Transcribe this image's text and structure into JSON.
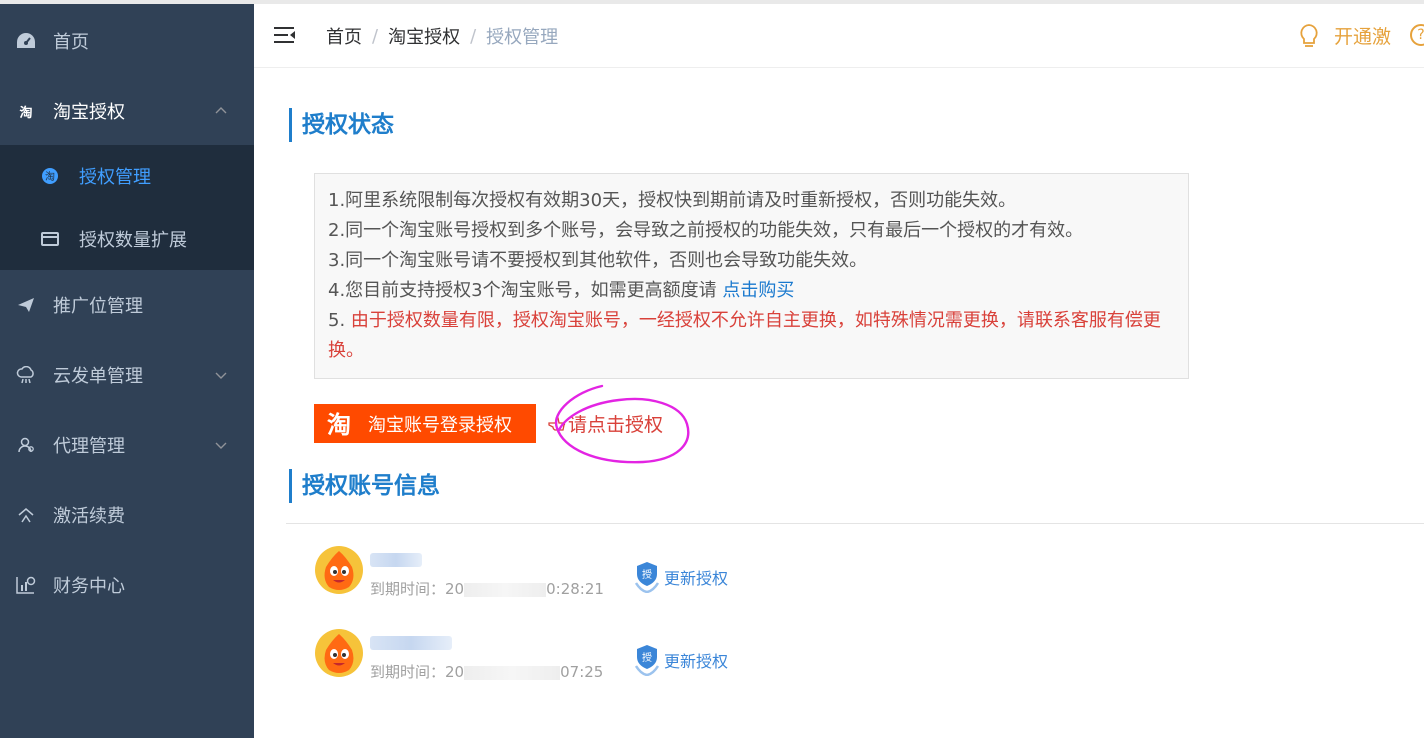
{
  "sidebar": {
    "items": [
      {
        "label": "首页",
        "icon": "dashboard-icon"
      },
      {
        "label": "淘宝授权",
        "icon": "taobao-icon"
      },
      {
        "label": "推广位管理",
        "icon": "send-icon"
      },
      {
        "label": "云发单管理",
        "icon": "cloud-icon"
      },
      {
        "label": "代理管理",
        "icon": "user-group-icon"
      },
      {
        "label": "激活续费",
        "icon": "activate-icon"
      },
      {
        "label": "财务中心",
        "icon": "finance-icon"
      }
    ],
    "submenu": [
      {
        "label": "授权管理",
        "icon": "taobao-badge-icon"
      },
      {
        "label": "授权数量扩展",
        "icon": "card-icon"
      }
    ]
  },
  "header": {
    "breadcrumb": [
      "首页",
      "淘宝授权",
      "授权管理"
    ],
    "separator": "/",
    "right_label": "开通激",
    "help_glyph": "?"
  },
  "content": {
    "status_title": "授权状态",
    "notices": [
      "1.阿里系统限制每次授权有效期30天，授权快到期前请及时重新授权，否则功能失效。",
      "2.同一个淘宝账号授权到多个账号，会导致之前授权的功能失效，只有最后一个授权的才有效。",
      "3.同一个淘宝账号请不要授权到其他软件，否则也会导致功能失效。"
    ],
    "notice4_prefix": "4.您目前支持授权3个淘宝账号，如需更高额度请 ",
    "notice4_link": "点击购买",
    "notice5_prefix": "5. ",
    "notice5_red": "由于授权数量有限，授权淘宝账号，一经授权不允许自主更换，如特殊情况需更换，请联系客服有偿更换。",
    "login_button": "淘宝账号登录授权",
    "login_logo": "淘",
    "hint": "请点击授权",
    "accounts_title": "授权账号信息",
    "accounts": [
      {
        "expire_label": "到期时间：",
        "expire_prefix": "20",
        "expire_suffix": "0:28:21",
        "renew_label": "更新授权"
      },
      {
        "expire_label": "到期时间：",
        "expire_prefix": "20",
        "expire_suffix": "07:25",
        "renew_label": "更新授权"
      }
    ]
  },
  "colors": {
    "sidebar_bg": "#304156",
    "submenu_bg": "#1f2d3d",
    "active": "#409eff",
    "accent_blue": "#1f7ecb",
    "taobao_orange": "#ff4a00",
    "warning_red": "#d9413a",
    "annotation_magenta": "#e324e3"
  }
}
